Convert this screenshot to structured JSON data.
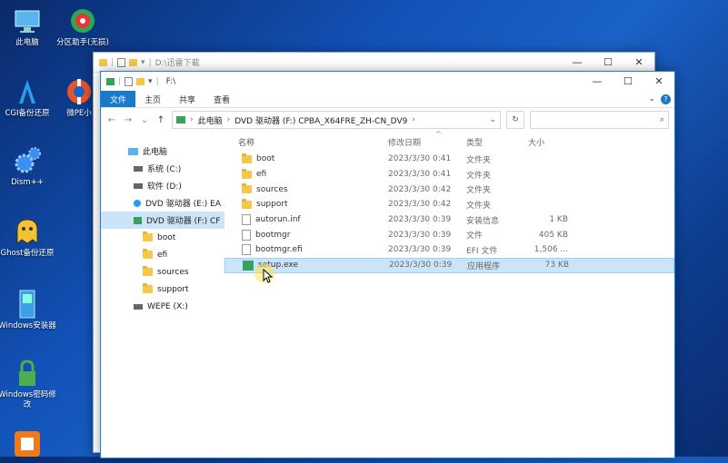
{
  "desktop": {
    "icons": [
      {
        "label": "此电脑"
      },
      {
        "label": "分区助手(无损)"
      },
      {
        "label": "CGI备份还原"
      },
      {
        "label": "微PE小"
      },
      {
        "label": "Dism++"
      },
      {
        "label": "Ghost备份还原"
      },
      {
        "label": "Windows安装器"
      },
      {
        "label": "Windows密码修改"
      }
    ]
  },
  "back_window": {
    "path": "D:\\迅雷下载"
  },
  "window": {
    "title": "F:\\",
    "tabs": [
      "文件",
      "主页",
      "共享",
      "查看"
    ],
    "address": {
      "root": "此电脑",
      "drive": "DVD 驱动器 (F:) CPBA_X64FRE_ZH-CN_DV9"
    },
    "columns": {
      "name": "名称",
      "date": "修改日期",
      "type": "类型",
      "size": "大小"
    },
    "nav": [
      {
        "label": "此电脑"
      },
      {
        "label": "系统 (C:)"
      },
      {
        "label": "软件 (D:)"
      },
      {
        "label": "DVD 驱动器 (E:) EA"
      },
      {
        "label": "DVD 驱动器 (F:) CF"
      },
      {
        "label": "boot"
      },
      {
        "label": "efi"
      },
      {
        "label": "sources"
      },
      {
        "label": "support"
      },
      {
        "label": "WEPE (X:)"
      }
    ],
    "files": [
      {
        "name": "boot",
        "date": "2023/3/30 0:41",
        "type": "文件夹",
        "size": ""
      },
      {
        "name": "efi",
        "date": "2023/3/30 0:41",
        "type": "文件夹",
        "size": ""
      },
      {
        "name": "sources",
        "date": "2023/3/30 0:42",
        "type": "文件夹",
        "size": ""
      },
      {
        "name": "support",
        "date": "2023/3/30 0:42",
        "type": "文件夹",
        "size": ""
      },
      {
        "name": "autorun.inf",
        "date": "2023/3/30 0:39",
        "type": "安装信息",
        "size": "1 KB"
      },
      {
        "name": "bootmgr",
        "date": "2023/3/30 0:39",
        "type": "文件",
        "size": "405 KB"
      },
      {
        "name": "bootmgr.efi",
        "date": "2023/3/30 0:39",
        "type": "EFI 文件",
        "size": "1,506 ..."
      },
      {
        "name": "setup.exe",
        "date": "2023/3/30 0:39",
        "type": "应用程序",
        "size": "73 KB"
      }
    ]
  },
  "colors": {
    "accent": "#1979ca",
    "selection": "#cce4f7",
    "folder": "#f5c84b"
  }
}
